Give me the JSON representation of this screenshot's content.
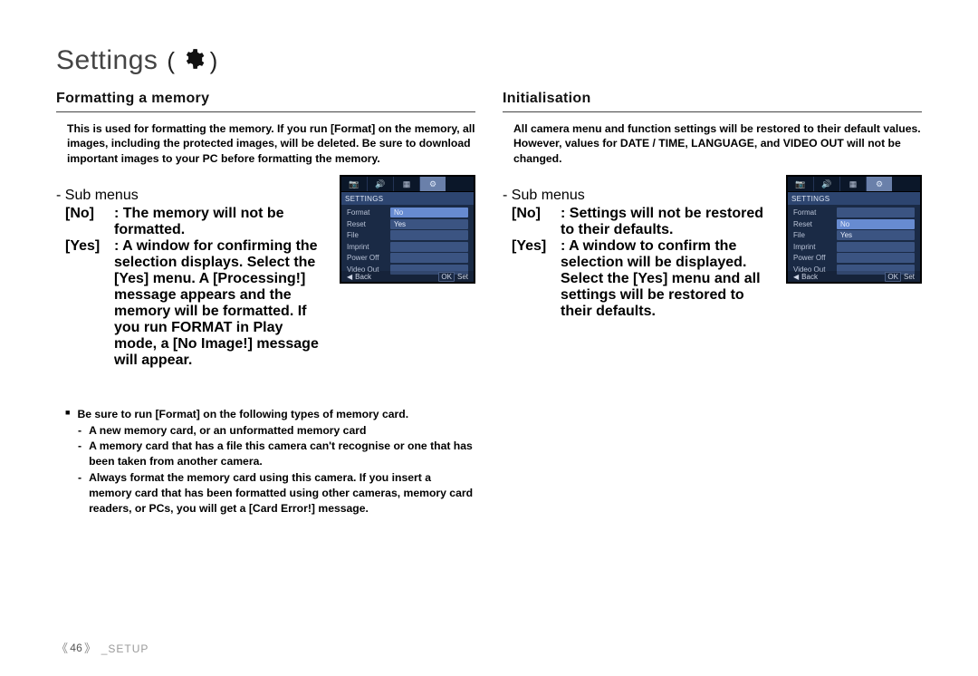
{
  "header": {
    "title": "Settings",
    "lparen": "(",
    "rparen": ")"
  },
  "left": {
    "title": "Formatting a memory",
    "intro": "This is used for formatting the memory. If you run [Format] on the memory, all images, including the protected images, will be deleted. Be sure to download important images to your PC before formatting the memory.",
    "submenu_label": "- Sub menus",
    "sub_items": [
      {
        "key": "[No]",
        "val": ": The memory will not be formatted."
      },
      {
        "key": "[Yes]",
        "val": ": A window for confirming the selection displays. Select the [Yes] menu. A [Processing!] message appears and the memory will be formatted. If you run FORMAT in Play mode, a [No Image!] message will appear."
      }
    ],
    "bullets": {
      "lead": "Be sure to run [Format] on the following types of memory card.",
      "items": [
        "A new memory card, or an unformatted memory card",
        "A memory card that has a file this camera can't recognise or one that has been taken from another camera.",
        "Always format the memory card using this camera. If you insert a memory card that has been formatted using other cameras, memory card readers, or PCs, you will get a [Card Error!] message."
      ]
    }
  },
  "right": {
    "title": "Initialisation",
    "intro": "All camera menu and function settings will be restored to their default values. However, values for DATE / TIME, LANGUAGE, and VIDEO OUT will not be changed.",
    "submenu_label": "- Sub menus",
    "sub_items": [
      {
        "key": "[No]",
        "val": ": Settings will not be restored to their defaults."
      },
      {
        "key": "[Yes]",
        "val": ": A window to confirm the selection will be displayed. Select the [Yes] menu and all settings will be restored to their defaults."
      }
    ]
  },
  "thumb": {
    "top_icons": [
      "📷",
      "🔊",
      "▦",
      "⚙"
    ],
    "bar": "SETTINGS",
    "left_rows": [
      {
        "label": "Format",
        "val": "No"
      },
      {
        "label": "Reset",
        "val": "Yes"
      },
      {
        "label": "File",
        "val": ""
      },
      {
        "label": "Imprint",
        "val": ""
      },
      {
        "label": "Power Off",
        "val": ""
      },
      {
        "label": "Video Out",
        "val": ""
      }
    ],
    "right_rows": [
      {
        "label": "Format",
        "val": ""
      },
      {
        "label": "Reset",
        "val": "No"
      },
      {
        "label": "File",
        "val": "Yes"
      },
      {
        "label": "Imprint",
        "val": ""
      },
      {
        "label": "Power Off",
        "val": ""
      },
      {
        "label": "Video Out",
        "val": ""
      }
    ],
    "footer_back": "Back",
    "footer_set": "Set",
    "footer_ok": "OK"
  },
  "footer": {
    "page_l": "《",
    "page_num": "46",
    "page_r": "》",
    "chapter": "_SETUP"
  }
}
